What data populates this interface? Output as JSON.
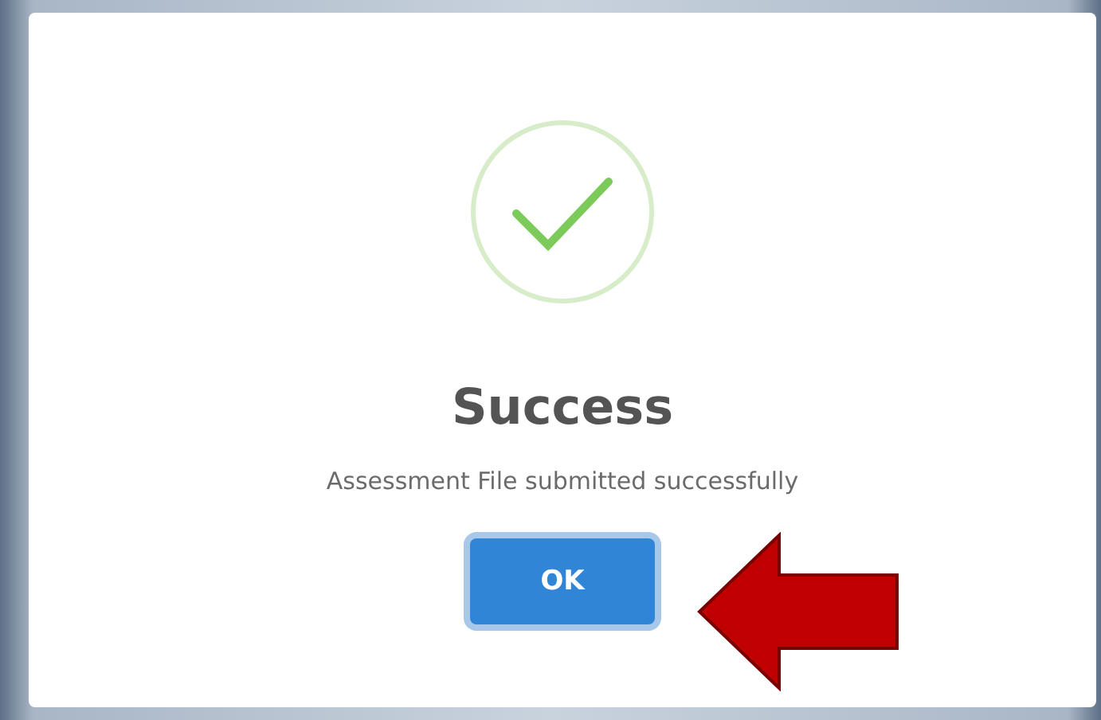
{
  "dialog": {
    "icon": {
      "kind": "success"
    },
    "title": "Success",
    "message": "Assessment File submitted successfully",
    "buttons": [
      {
        "label": "OK",
        "focused": true
      }
    ]
  }
}
